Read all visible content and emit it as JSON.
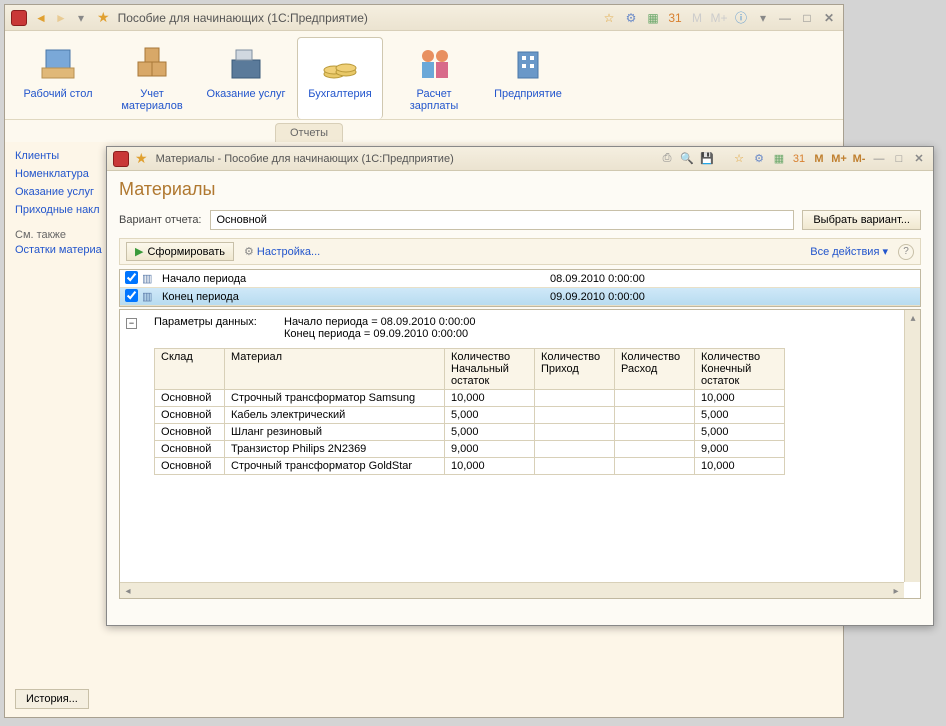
{
  "main_window": {
    "title": "Пособие для начинающих  (1С:Предприятие)"
  },
  "ribbon": [
    {
      "label": "Рабочий стол"
    },
    {
      "label": "Учет материалов"
    },
    {
      "label": "Оказание услуг"
    },
    {
      "label": "Бухгалтерия"
    },
    {
      "label": "Расчет зарплаты"
    },
    {
      "label": "Предприятие"
    }
  ],
  "tabs": {
    "reports": "Отчеты"
  },
  "left_nav": {
    "items": [
      "Клиенты",
      "Номенклатура",
      "Оказание услуг",
      "Приходные накл"
    ],
    "see_also_label": "См. также",
    "see_also_items": [
      "Остатки материа"
    ]
  },
  "history_btn": "История...",
  "sub_window": {
    "title": "Материалы - Пособие для начинающих  (1С:Предприятие)",
    "heading": "Материалы",
    "variant_label": "Вариант отчета:",
    "variant_value": "Основной",
    "choose_variant": "Выбрать вариант...",
    "form_btn": "Сформировать",
    "settings": "Настройка...",
    "all_actions": "Все действия ▾",
    "m_buttons": [
      "M",
      "M+",
      "M-"
    ]
  },
  "params": [
    {
      "name": "Начало периода",
      "value": "08.09.2010 0:00:00",
      "checked": true,
      "selected": false
    },
    {
      "name": "Конец периода",
      "value": "09.09.2010 0:00:00",
      "checked": true,
      "selected": true
    }
  ],
  "report": {
    "param_summary_label": "Параметры данных:",
    "param_lines": [
      "Начало периода = 08.09.2010 0:00:00",
      "Конец периода = 09.09.2010 0:00:00"
    ],
    "columns": [
      "Склад",
      "Материал",
      "Количество Начальный остаток",
      "Количество Приход",
      "Количество Расход",
      "Количество Конечный остаток"
    ],
    "rows": [
      {
        "sklad": "Основной",
        "material": "Строчный трансформатор Samsung",
        "start": "10,000",
        "in": "",
        "out": "",
        "end": "10,000"
      },
      {
        "sklad": "Основной",
        "material": "Кабель электрический",
        "start": "5,000",
        "in": "",
        "out": "",
        "end": "5,000"
      },
      {
        "sklad": "Основной",
        "material": "Шланг резиновый",
        "start": "5,000",
        "in": "",
        "out": "",
        "end": "5,000"
      },
      {
        "sklad": "Основной",
        "material": "Транзистор Philips 2N2369",
        "start": "9,000",
        "in": "",
        "out": "",
        "end": "9,000"
      },
      {
        "sklad": "Основной",
        "material": "Строчный трансформатор GoldStar",
        "start": "10,000",
        "in": "",
        "out": "",
        "end": "10,000"
      }
    ]
  }
}
